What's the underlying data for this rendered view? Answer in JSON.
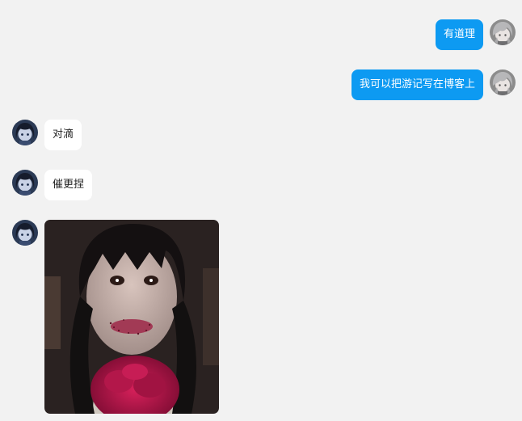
{
  "colors": {
    "background": "#f2f2f2",
    "outgoing_bubble": "#0d9af2",
    "incoming_bubble": "#ffffff"
  },
  "messages": [
    {
      "direction": "outgoing",
      "text": "有道理",
      "avatar_icon": "gray-haired-anime-avatar"
    },
    {
      "direction": "outgoing",
      "text": "我可以把游记写在博客上",
      "avatar_icon": "gray-haired-anime-avatar"
    },
    {
      "direction": "incoming",
      "text": "对滴",
      "avatar_icon": "dark-haired-anime-avatar"
    },
    {
      "direction": "incoming",
      "text": "催更捏",
      "avatar_icon": "dark-haired-anime-avatar"
    },
    {
      "direction": "incoming",
      "type": "image",
      "avatar_icon": "dark-haired-anime-avatar",
      "image_icon": "photo-girl-with-bangs-and-red-flower"
    }
  ]
}
